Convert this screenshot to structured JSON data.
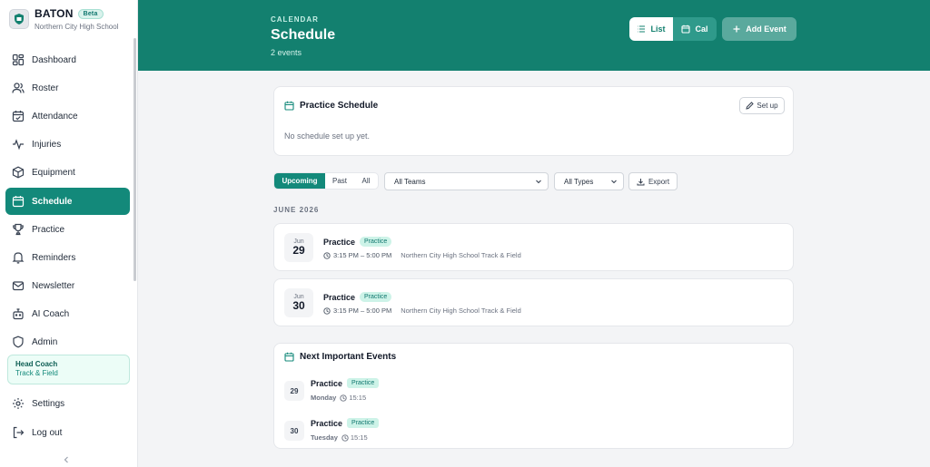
{
  "app": {
    "name": "BATON",
    "badge": "Beta",
    "school": "Northern City High School"
  },
  "sidebar": {
    "items": [
      {
        "label": "Dashboard",
        "icon": "grid-icon"
      },
      {
        "label": "Roster",
        "icon": "users-icon"
      },
      {
        "label": "Attendance",
        "icon": "calendar-check-icon"
      },
      {
        "label": "Injuries",
        "icon": "pulse-icon"
      },
      {
        "label": "Equipment",
        "icon": "box-icon"
      },
      {
        "label": "Schedule",
        "icon": "calendar-icon",
        "active": true
      },
      {
        "label": "Practice",
        "icon": "trophy-icon"
      },
      {
        "label": "Reminders",
        "icon": "bell-icon"
      },
      {
        "label": "Newsletter",
        "icon": "mail-icon"
      },
      {
        "label": "AI Coach",
        "icon": "bot-icon"
      },
      {
        "label": "Admin",
        "icon": "shield-icon"
      }
    ],
    "role": {
      "title": "Head Coach",
      "subtitle": "Track & Field"
    },
    "settings_label": "Settings",
    "logout_label": "Log out"
  },
  "header": {
    "eyebrow": "CALENDAR",
    "title": "Schedule",
    "count": "2 events",
    "view_list": "List",
    "view_cal": "Cal",
    "add_event": "Add Event"
  },
  "practice_schedule": {
    "title": "Practice Schedule",
    "setup_label": "Set up",
    "empty": "No schedule set up yet."
  },
  "filters": {
    "tabs": [
      "Upcoming",
      "Past",
      "All"
    ],
    "active_tab": "Upcoming",
    "team_select": "All Teams",
    "type_select": "All Types",
    "export_label": "Export"
  },
  "events": {
    "month": "JUNE 2026",
    "items": [
      {
        "mon": "Jun",
        "day": "29",
        "title": "Practice",
        "tag": "Practice",
        "time": "3:15 PM – 5:00 PM",
        "location": "Northern City High School Track & Field"
      },
      {
        "mon": "Jun",
        "day": "30",
        "title": "Practice",
        "tag": "Practice",
        "time": "3:15 PM – 5:00 PM",
        "location": "Northern City High School Track & Field"
      }
    ]
  },
  "important": {
    "title": "Next Important Events",
    "items": [
      {
        "day": "29",
        "title": "Practice",
        "tag": "Practice",
        "weekday": "Monday",
        "time": "15:15"
      },
      {
        "day": "30",
        "title": "Practice",
        "tag": "Practice",
        "weekday": "Tuesday",
        "time": "15:15"
      }
    ]
  },
  "colors": {
    "brand": "#13806f",
    "active": "#13897a",
    "tag_bg": "#cdf3e8",
    "tag_text": "#0f766e"
  }
}
